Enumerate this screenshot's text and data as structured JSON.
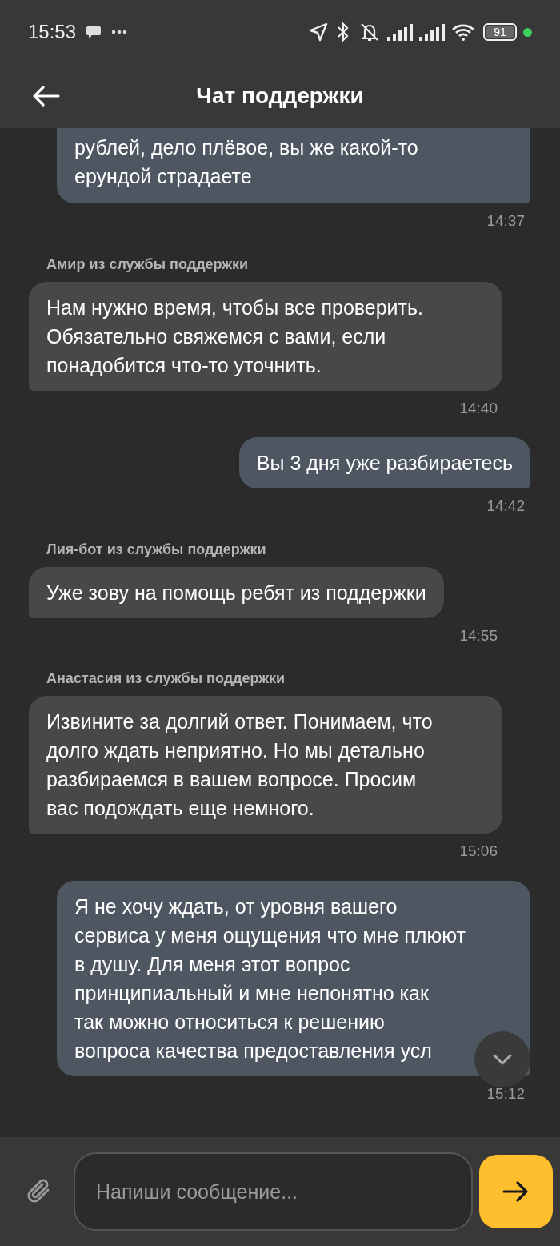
{
  "status_bar": {
    "time": "15:53",
    "battery": "91"
  },
  "header": {
    "title": "Чат поддержки"
  },
  "messages": [
    {
      "kind": "outgoing",
      "text": "рублей, дело плёвое, вы же какой-то\nерундой страдаете",
      "time": "14:37",
      "cut_top": true
    },
    {
      "kind": "incoming",
      "sender": "Амир из службы поддержки",
      "text": "Нам нужно время, чтобы все проверить.\nОбязательно свяжемся с вами, если\nпонадобится что-то уточнить.",
      "time": "14:40"
    },
    {
      "kind": "outgoing",
      "text": "Вы 3 дня уже разбираетесь",
      "time": "14:42"
    },
    {
      "kind": "incoming",
      "sender": "Лия-бот из службы поддержки",
      "text": "Уже зову на помощь ребят из поддержки",
      "time": "14:55"
    },
    {
      "kind": "incoming",
      "sender": "Анастасия из службы поддержки",
      "text": "Извините за долгий ответ. Понимаем, что\nдолго ждать неприятно. Но мы детально\nразбираемся в вашем вопросе. Просим\nвас подождать еще немного.",
      "time": "15:06"
    },
    {
      "kind": "outgoing",
      "text": "Я не хочу ждать, от уровня вашего\nсервиса у меня ощущения что мне плюют\nв душу. Для меня этот вопрос\nпринципиальный и мне непонятно как\nтак можно относиться к решению\nвопроса качества предоставления усл",
      "time": "15:12"
    }
  ],
  "composer": {
    "placeholder": "Напиши сообщение..."
  }
}
